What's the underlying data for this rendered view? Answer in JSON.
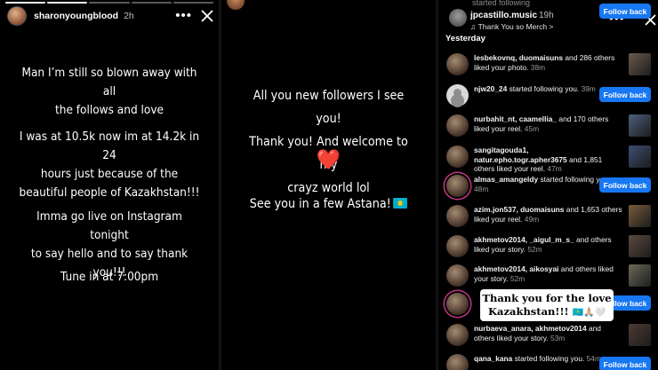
{
  "story1": {
    "username": "sharonyoungblood",
    "time": "2h",
    "paragraphs": [
      [
        "Man I’m still so blown away with all",
        "the follows and love"
      ],
      [
        "I was at 10.5k now im at 14.2k in 24",
        "hours just because of the",
        "beautiful people of Kazakhstan!!!"
      ],
      [
        "Imma go live on Instagram tonight",
        "to say hello and to say thank you!!!"
      ],
      [
        "Tune in at 7:00pm"
      ]
    ]
  },
  "story2": {
    "lines": [
      "All you new followers I see you!",
      "Thank you! And welcome to my",
      "crayz world lol"
    ],
    "heart": "❤️",
    "footer": "See you in a few Astana!"
  },
  "story3": {
    "faded_top": "started following",
    "story_user": "jpcastillo.music",
    "story_time": "19h",
    "song": "♫ Thank You so Merch >",
    "section": "Yesterday",
    "notifications": [
      {
        "user": "lesbekovnq, duomaisuns",
        "rest": " and 286 others liked your photo.",
        "time": "38m",
        "action": "thumb",
        "av": "photo"
      },
      {
        "user": "njw20_24",
        "rest": " started following you.",
        "time": "39m",
        "action": "follow",
        "av": "grey"
      },
      {
        "user": "nurbahit_nt, caamellia_",
        "rest": " and 170 others liked your reel.",
        "time": "45m",
        "action": "thumb",
        "av": "photo"
      },
      {
        "user": "sangitagouda1, natur.epho.togr.apher3675",
        "rest": " and 1,851 others liked your reel.",
        "time": "47m",
        "action": "thumb",
        "av": "photo"
      },
      {
        "user": "almas_amangeldy",
        "rest": " started following you.",
        "time": "48m",
        "action": "follow",
        "av": "ring"
      },
      {
        "user": "azim.jon537, duomaisuns",
        "rest": " and 1,653 others liked your reel.",
        "time": "49m",
        "action": "thumb",
        "av": "photo"
      },
      {
        "user": "akhmetov2014, _aigul_m_s_",
        "rest": " and others liked your story.",
        "time": "52m",
        "action": "thumb",
        "av": "photo"
      },
      {
        "user": "akhmetov2014, aikosyai",
        "rest": " and others liked your story.",
        "time": "52m",
        "action": "thumb",
        "av": "photo"
      },
      {
        "user": "",
        "rest": "",
        "time": "",
        "action": "follow",
        "av": "ring"
      },
      {
        "user": "nurbaeva_anara, akhmetov2014",
        "rest": " and others liked your story.",
        "time": "53m",
        "action": "thumb",
        "av": "photo"
      },
      {
        "user": "qana_kana",
        "rest": " started following you.",
        "time": "54m",
        "action": "follow",
        "av": "photo"
      }
    ],
    "follow_back_label": "Follow back",
    "sticker_line1": "Thank you for the love",
    "sticker_line2": "Kazakhstan!!!",
    "sticker_emoji": "🇰🇿🙏🏼🤍"
  },
  "colors": {
    "follow_blue": "#1877f2",
    "heart_red": "#ff2a3d",
    "flag_kz": "#00afca"
  }
}
